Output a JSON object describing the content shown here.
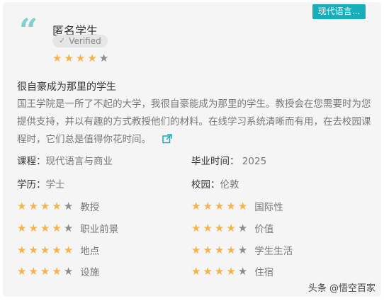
{
  "tag": "现代语言...",
  "reviewer": {
    "avatar_icon": "quote-icon",
    "name": "匿名学生",
    "verified": "Verified"
  },
  "overall_rating": 4,
  "review": {
    "title": "很自豪成为那里的学生",
    "body": "国王学院是一所了不起的大学，我很自豪能成为那里的学生。教授会在您需要时为您提供支持，并以有趣的方式教授他们的材料。在线学习系统清晰而有用，在去校园课程时，它们总是值得你花时间。"
  },
  "details": {
    "course_label": "课程：",
    "course_value": "现代语言与商业",
    "grad_label": "毕业时间：",
    "grad_value": "2025",
    "degree_label": "学历：",
    "degree_value": "学士",
    "campus_label": "校园：",
    "campus_value": "伦敦"
  },
  "ratings": [
    {
      "label": "教授",
      "stars": 4
    },
    {
      "label": "国际性",
      "stars": 5
    },
    {
      "label": "职业前景",
      "stars": 4
    },
    {
      "label": "价值",
      "stars": 4
    },
    {
      "label": "地点",
      "stars": 5
    },
    {
      "label": "学生生活",
      "stars": 4
    },
    {
      "label": "设施",
      "stars": 4
    },
    {
      "label": "住宿",
      "stars": 4
    }
  ],
  "watermark": "头条 @悟空百家",
  "colors": {
    "accent": "#17aeb9",
    "star_on": "#f5b34a",
    "star_off": "#8c8c8c"
  }
}
